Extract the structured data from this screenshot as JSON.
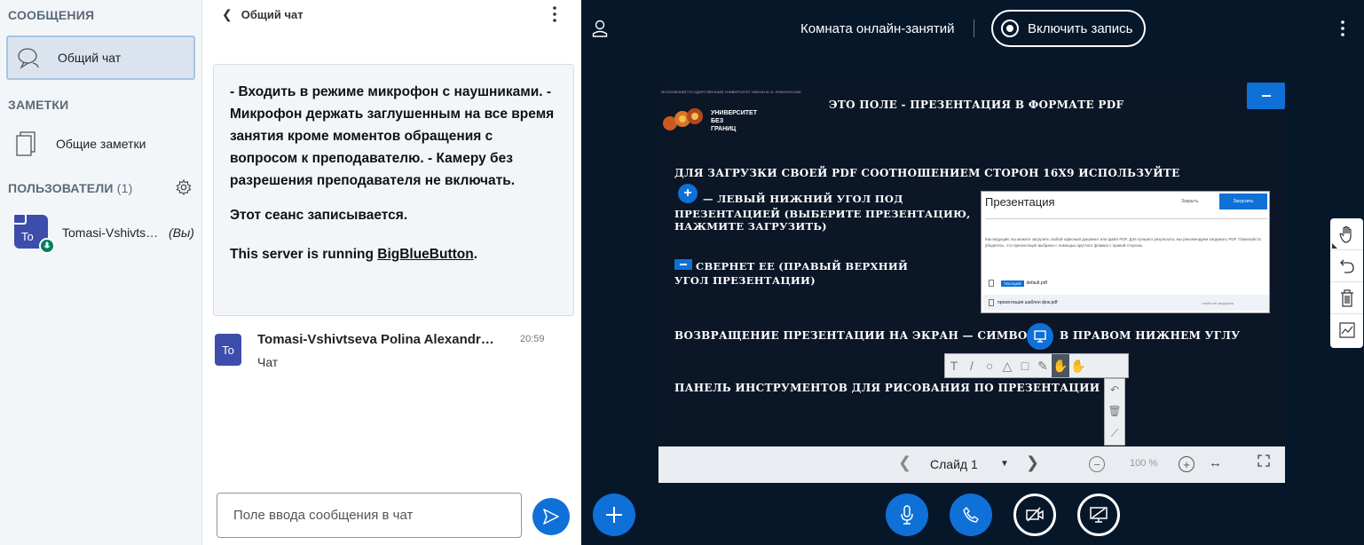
{
  "left_panel": {
    "messages_header": "СООБЩЕНИЯ",
    "chat_item_label": "Общий чат",
    "notes_header": "ЗАМЕТКИ",
    "notes_item_label": "Общие заметки",
    "users_header": "ПОЛЬЗОВАТЕЛИ",
    "users_count": "(1)",
    "user": {
      "initials": "To",
      "name": "Tomasi-Vshivts…",
      "you_label": "(Вы)"
    }
  },
  "chat": {
    "title": "Общий чат",
    "welcome": {
      "rules": "- Входить в режиме микрофон с наушниками. - Микрофон держать заглушенным на все время занятия кроме моментов обращения с вопросом к преподавателю. - Камеру без разрешения преподавателя не включать.",
      "recording": "Этот сеанс записывается.",
      "server_prefix": "This server is running ",
      "server_link": "BigBlueButton",
      "server_suffix": "."
    },
    "messages": [
      {
        "initials": "To",
        "sender": "Tomasi-Vshivtseva Polina Alexandr…",
        "time": "20:59",
        "text": "Чат"
      }
    ],
    "input_placeholder": "Поле ввода сообщения в чат"
  },
  "header": {
    "room_title": "Комната онлайн-занятий",
    "record_label": "Включить запись"
  },
  "presentation": {
    "logo": {
      "top_text": "МОСКОВСКИЙ ГОСУДАРСТВЕННЫЙ УНИВЕРСИТЕТ ИМЕНИ М. В. ЛОМОНОСОВА",
      "name_lines": [
        "УНИВЕРСИТЕТ",
        "БЕЗ",
        "ГРАНИЦ"
      ]
    },
    "slide_title": "ЭТО ПОЛЕ - ПРЕЗЕНТАЦИЯ В ФОРМАТЕ PDF",
    "line1": "ДЛЯ ЗАГРУЗКИ СВОЕЙ PDF  СООТНОШЕНИЕМ СТОРОН 16X9 ИСПОЛЬЗУЙТЕ",
    "line2": "— ЛЕВЫЙ  НИЖНИЙ УГОЛ ПОД",
    "line3": "ПРЕЗЕНТАЦИЕЙ (ВЫБЕРИТЕ ПРЕЗЕНТАЦИЮ,",
    "line4": "НАЖМИТЕ ЗАГРУЗИТЬ)",
    "line5": "СВЕРНЕТ ЕЕ (ПРАВЫЙ ВЕРХНИЙ",
    "line6": "УГОЛ ПРЕЗЕНТАЦИИ)",
    "line7": "ВОЗВРАЩЕНИЕ ПРЕЗЕНТАЦИИ НА ЭКРАН — СИМВОЛ",
    "line9": "В ПРАВОМ НИЖНЕМ УГЛУ",
    "line8": "ПАНЕЛЬ ИНСТРУМЕНТОВ ДЛЯ РИСОВАНИЯ ПО ПРЕЗЕНТАЦИИ —",
    "upload_dialog": {
      "title": "Презентация",
      "close": "Закрыть",
      "upload": "Загрузить",
      "description": "Как ведущий, вы можете загрузить любой офисный документ или файл PDF. Для лучшего результата, мы рекомендуем загружать PDF. Пожалуйста убедитесь, что презентация выбрана с помощью круглого флажка с правой стороны.",
      "file1_tag": "ТЕКУЩИЙ",
      "file1_name": "default.pdf",
      "file2_name": "презентация шаблон фок.pdf",
      "file2_hint": "чтобы ее загрузить"
    },
    "toolbar_glyphs": [
      "T",
      "/",
      "○",
      "△",
      "□",
      "✎",
      "✋",
      "✋"
    ],
    "toolbar_col_glyphs": [
      "↶",
      "🗑",
      "⟋"
    ]
  },
  "pres_bar": {
    "slide_label": "Слайд 1",
    "zoom": "100 %"
  },
  "colors": {
    "accent": "#0f70d7",
    "main_bg": "#06172a",
    "avatar": "#3d4dab",
    "mic_badge": "#00805f"
  }
}
